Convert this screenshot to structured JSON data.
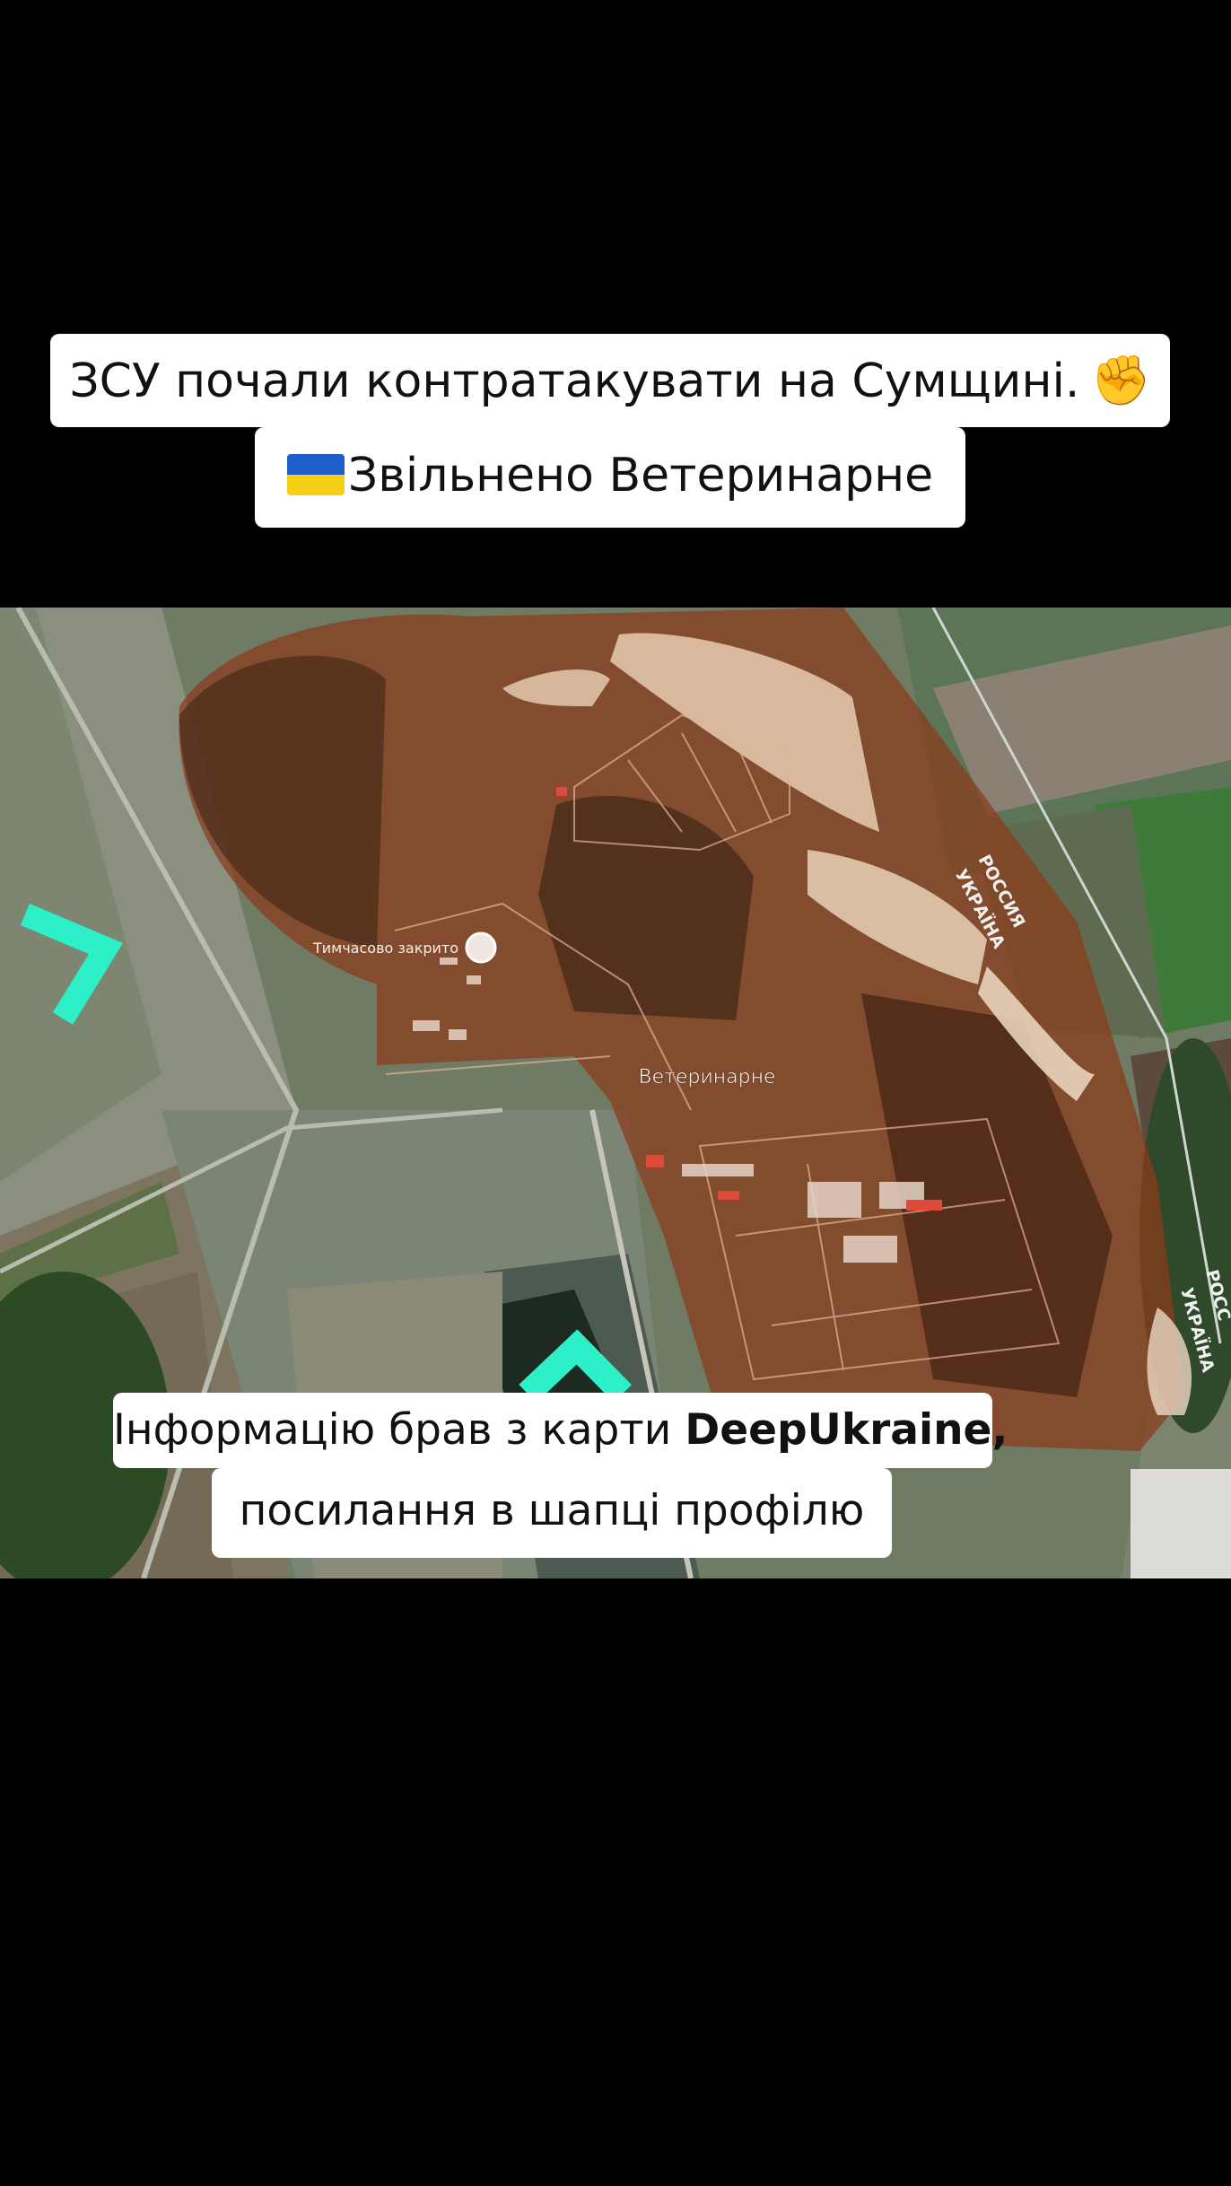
{
  "captions": {
    "line1": "ЗСУ почали контратакувати на Сумщині.",
    "fist_emoji": "✊",
    "flag": "ukraine-flag",
    "line2": "Звільнено Ветеринарне",
    "line3_prefix": "Інформацію брав з карти ",
    "line3_brand": "DeepUkraine,",
    "line4": "посилання в шапці профілю"
  },
  "map": {
    "village_label": "Ветеринарне",
    "poi_label": "Тимчасово закрито",
    "border_label_ru_1": "РОССИЯ",
    "border_label_ua_1": "УКРАЇНА",
    "border_label_ru_2": "РОСС",
    "border_label_ua_2": "УКРАЇНА",
    "colors": {
      "overlay": "#8b3a1a",
      "arrow": "#2ef0c8",
      "field_green": "#6a7a54",
      "forest": "#2c4a24"
    }
  }
}
